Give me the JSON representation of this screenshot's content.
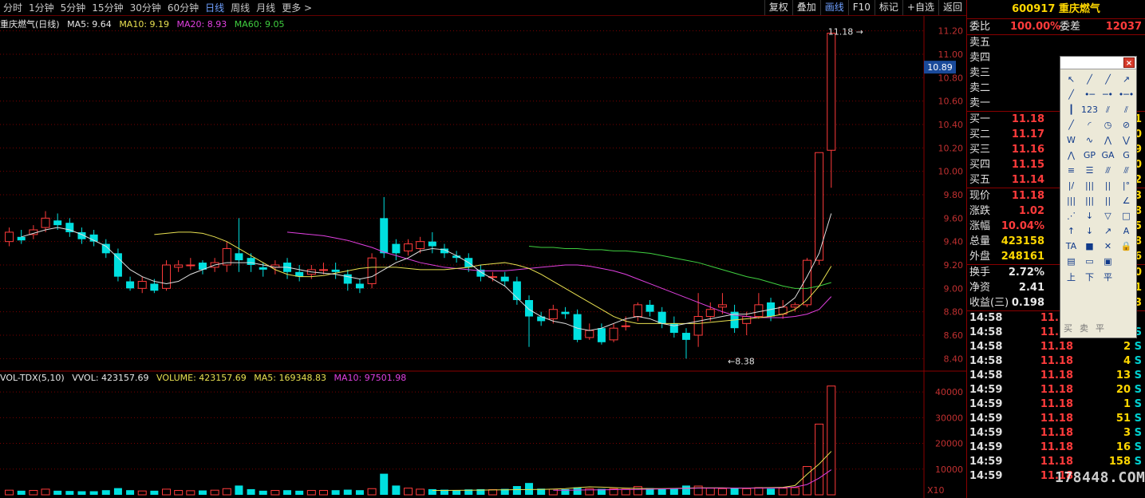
{
  "toolbar": {
    "periods": [
      "分时",
      "1分钟",
      "5分钟",
      "15分钟",
      "30分钟",
      "60分钟",
      "日线",
      "周线",
      "月线",
      "更多 >"
    ],
    "active_period": "日线",
    "right_buttons": [
      "复权",
      "叠加",
      "画线",
      "F10",
      "标记",
      "+自选",
      "返回"
    ],
    "highlight_button": "画线"
  },
  "price_legend": {
    "title": "重庆燃气(日线)",
    "ma5": "MA5: 9.64",
    "ma10": "MA10: 9.19",
    "ma20": "MA20: 8.93",
    "ma60": "MA60: 9.05"
  },
  "volume_legend": {
    "indicator": "VOL-TDX(5,10)",
    "vvol": "VVOL: 423157.69",
    "volume": "VOLUME: 423157.69",
    "ma5": "MA5: 169348.83",
    "ma10": "MA10: 97501.98"
  },
  "annotations": {
    "high_label": "11.18",
    "low_label": "8.38",
    "current_price_tag": "10.89",
    "volume_unit": "X10"
  },
  "colors": {
    "up": "#ff3b3b",
    "down": "#00e0e0",
    "ma5": "#e0e0e0",
    "ma10": "#e8e050",
    "ma20": "#e040e0",
    "ma60": "#40d040",
    "grid": "#7a0000",
    "axis_text": "#c03030"
  },
  "chart_data": [
    {
      "type": "candlestick",
      "title": "重庆燃气(日线)",
      "ylim": [
        8.3,
        11.3
      ],
      "yticks": [
        8.4,
        8.6,
        8.8,
        9.0,
        9.2,
        9.4,
        9.6,
        9.8,
        10.0,
        10.2,
        10.4,
        10.6,
        10.8,
        11.0,
        11.2
      ],
      "candles": [
        [
          9.4,
          9.48,
          9.52,
          9.36
        ],
        [
          9.44,
          9.41,
          9.5,
          9.38
        ],
        [
          9.46,
          9.5,
          9.54,
          9.42
        ],
        [
          9.52,
          9.6,
          9.66,
          9.48
        ],
        [
          9.58,
          9.54,
          9.64,
          9.5
        ],
        [
          9.56,
          9.48,
          9.6,
          9.44
        ],
        [
          9.48,
          9.42,
          9.52,
          9.38
        ],
        [
          9.46,
          9.4,
          9.5,
          9.36
        ],
        [
          9.38,
          9.3,
          9.42,
          9.26
        ],
        [
          9.3,
          9.1,
          9.34,
          9.06
        ],
        [
          9.06,
          9.0,
          9.1,
          8.98
        ],
        [
          9.0,
          9.06,
          9.1,
          8.96
        ],
        [
          9.04,
          8.98,
          9.08,
          8.96
        ],
        [
          9.0,
          9.2,
          9.24,
          8.98
        ],
        [
          9.18,
          9.2,
          9.24,
          9.14
        ],
        [
          9.2,
          9.2,
          9.26,
          9.16
        ],
        [
          9.22,
          9.16,
          9.24,
          9.12
        ],
        [
          9.18,
          9.22,
          9.26,
          9.14
        ],
        [
          9.2,
          9.34,
          9.4,
          9.14
        ],
        [
          9.3,
          9.24,
          9.6,
          9.14
        ],
        [
          9.26,
          9.2,
          9.3,
          9.14
        ],
        [
          9.18,
          9.16,
          9.22,
          9.1
        ],
        [
          9.18,
          9.2,
          9.24,
          9.12
        ],
        [
          9.22,
          9.14,
          9.26,
          9.08
        ],
        [
          9.14,
          9.1,
          9.2,
          9.06
        ],
        [
          9.12,
          9.16,
          9.2,
          9.08
        ],
        [
          9.16,
          9.16,
          9.22,
          9.12
        ],
        [
          9.16,
          9.14,
          9.22,
          9.08
        ],
        [
          9.12,
          9.04,
          9.16,
          8.98
        ],
        [
          9.04,
          9.0,
          9.08,
          8.96
        ],
        [
          9.04,
          9.26,
          9.3,
          9.0
        ],
        [
          9.6,
          9.3,
          9.78,
          9.26
        ],
        [
          9.38,
          9.3,
          9.42,
          9.24
        ],
        [
          9.32,
          9.38,
          9.42,
          9.28
        ],
        [
          9.34,
          9.4,
          9.44,
          9.3
        ],
        [
          9.4,
          9.36,
          9.48,
          9.3
        ],
        [
          9.34,
          9.3,
          9.38,
          9.26
        ],
        [
          9.28,
          9.26,
          9.32,
          9.22
        ],
        [
          9.26,
          9.18,
          9.3,
          9.14
        ],
        [
          9.16,
          9.1,
          9.2,
          9.06
        ],
        [
          9.1,
          9.1,
          9.14,
          9.06
        ],
        [
          9.1,
          9.06,
          9.14,
          9.02
        ],
        [
          9.06,
          8.9,
          9.1,
          8.86
        ],
        [
          8.9,
          8.76,
          8.94,
          8.5
        ],
        [
          8.76,
          8.72,
          8.8,
          8.68
        ],
        [
          8.74,
          8.82,
          8.86,
          8.7
        ],
        [
          8.8,
          8.78,
          8.84,
          8.74
        ],
        [
          8.78,
          8.56,
          8.82,
          8.54
        ],
        [
          8.58,
          8.64,
          8.7,
          8.56
        ],
        [
          8.66,
          8.54,
          8.7,
          8.52
        ],
        [
          8.56,
          8.66,
          8.7,
          8.54
        ],
        [
          8.68,
          8.68,
          8.76,
          8.64
        ],
        [
          8.76,
          8.86,
          8.88,
          8.72
        ],
        [
          8.86,
          8.8,
          8.9,
          8.76
        ],
        [
          8.8,
          8.7,
          8.84,
          8.66
        ],
        [
          8.7,
          8.62,
          8.76,
          8.58
        ],
        [
          8.62,
          8.56,
          8.66,
          8.4
        ],
        [
          8.6,
          8.76,
          8.96,
          8.5
        ],
        [
          8.76,
          8.82,
          8.88,
          8.72
        ],
        [
          8.84,
          8.86,
          8.96,
          8.78
        ],
        [
          8.8,
          8.66,
          8.86,
          8.62
        ],
        [
          8.7,
          8.76,
          8.8,
          8.6
        ],
        [
          8.76,
          8.86,
          8.96,
          8.74
        ],
        [
          8.88,
          8.76,
          8.92,
          8.72
        ],
        [
          8.78,
          8.84,
          8.9,
          8.74
        ],
        [
          8.84,
          8.86,
          8.88,
          8.8
        ],
        [
          8.86,
          9.24,
          9.26,
          8.84
        ],
        [
          9.24,
          10.16,
          10.16,
          9.2
        ],
        [
          10.18,
          11.18,
          11.18,
          9.86
        ]
      ],
      "ma5": [
        9.44,
        9.47,
        9.5,
        9.52,
        9.5,
        9.46,
        9.41,
        9.36,
        9.26,
        9.16,
        9.1,
        9.06,
        9.04,
        9.06,
        9.12,
        9.16,
        9.2,
        9.22,
        9.22,
        9.22,
        9.2,
        9.18,
        9.18,
        9.16,
        9.14,
        9.13,
        9.12,
        9.1,
        9.08,
        9.1,
        9.16,
        9.22,
        9.26,
        9.32,
        9.34,
        9.33,
        9.28,
        9.22,
        9.14,
        9.08,
        9.02,
        8.92,
        8.82,
        8.76,
        8.72,
        8.7,
        8.66,
        8.64,
        8.66,
        8.7,
        8.74,
        8.76,
        8.74,
        8.7,
        8.68,
        8.7,
        8.72,
        8.74,
        8.76,
        8.78,
        8.78,
        8.8,
        8.82,
        8.84,
        8.92,
        9.1,
        9.3,
        9.64
      ],
      "ma10": [
        9.46,
        9.47,
        9.48,
        9.48,
        9.47,
        9.44,
        9.4,
        9.34,
        9.28,
        9.22,
        9.16,
        9.12,
        9.1,
        9.1,
        9.11,
        9.13,
        9.15,
        9.17,
        9.18,
        9.18,
        9.18,
        9.17,
        9.16,
        9.16,
        9.16,
        9.17,
        9.18,
        9.2,
        9.21,
        9.22,
        9.2,
        9.17,
        9.12,
        9.06,
        9.0,
        8.94,
        8.88,
        8.82,
        8.76,
        8.72,
        8.7,
        8.7,
        8.7,
        8.7,
        8.7,
        8.7,
        8.71,
        8.72,
        8.73,
        8.74,
        8.75,
        8.76,
        8.78,
        8.82,
        8.9,
        9.02,
        9.19
      ],
      "ma20": [
        9.48,
        9.47,
        9.46,
        9.45,
        9.43,
        9.41,
        9.38,
        9.35,
        9.31,
        9.28,
        9.25,
        9.22,
        9.2,
        9.18,
        9.17,
        9.16,
        9.15,
        9.15,
        9.15,
        9.16,
        9.17,
        9.18,
        9.19,
        9.2,
        9.2,
        9.19,
        9.17,
        9.15,
        9.12,
        9.08,
        9.04,
        9.0,
        8.96,
        8.92,
        8.88,
        8.84,
        8.8,
        8.77,
        8.76,
        8.75,
        8.75,
        8.75,
        8.76,
        8.78,
        8.82,
        8.93
      ],
      "ma60": [
        9.36,
        9.35,
        9.35,
        9.34,
        9.34,
        9.33,
        9.33,
        9.32,
        9.32,
        9.31,
        9.3,
        9.28,
        9.26,
        9.24,
        9.22,
        9.19,
        9.16,
        9.13,
        9.1,
        9.08,
        9.05,
        9.02,
        9.0,
        9.0,
        9.02,
        9.05
      ]
    },
    {
      "type": "bar",
      "title": "VOL-TDX(5,10)",
      "ylim": [
        0,
        45000
      ],
      "yticks": [
        10000,
        20000,
        30000,
        40000
      ],
      "volumes": [
        1800,
        1600,
        1700,
        2200,
        1600,
        1500,
        1400,
        1400,
        1800,
        2600,
        1800,
        1500,
        1600,
        2200,
        1700,
        1600,
        1700,
        1800,
        2400,
        3600,
        2200,
        1600,
        1700,
        1800,
        1600,
        1700,
        1700,
        1800,
        2000,
        1800,
        2400,
        8200,
        3600,
        2600,
        2200,
        2200,
        2000,
        1800,
        2100,
        2200,
        2000,
        2300,
        3400,
        4600,
        2400,
        2200,
        2200,
        2900,
        2400,
        2300,
        2400,
        2200,
        3200,
        2600,
        2300,
        2400,
        3600,
        3400,
        2600,
        2400,
        2600,
        2400,
        2800,
        2400,
        2600,
        2800,
        11000,
        27500,
        42300
      ],
      "vol_ma5": [
        1700,
        1720,
        1760,
        1800,
        1820,
        1900,
        1950,
        2000,
        2050,
        2100,
        2200,
        2400,
        2800,
        3100,
        3000,
        2800,
        2600,
        2500,
        2400,
        2400,
        2500,
        2600,
        2700,
        2700,
        2700,
        2600,
        2600,
        2700,
        2800,
        2900,
        3600,
        8000,
        12000,
        16900
      ],
      "vol_ma10": [
        1800,
        1800,
        1850,
        1900,
        1950,
        2000,
        2050,
        2100,
        2200,
        2300,
        2400,
        2500,
        2600,
        2600,
        2600,
        2600,
        2600,
        2600,
        2650,
        2700,
        3000,
        4000,
        6500,
        9750
      ]
    }
  ],
  "quote_panel": {
    "title": "600917 重庆燃气",
    "weibi_label": "委比",
    "weibi_value": "100.00%",
    "weicha_label": "委差",
    "weicha_value": "12037",
    "sells": [
      {
        "label": "卖五",
        "price": "",
        "vol": ""
      },
      {
        "label": "卖四",
        "price": "",
        "vol": ""
      },
      {
        "label": "卖三",
        "price": "",
        "vol": ""
      },
      {
        "label": "卖二",
        "price": "",
        "vol": ""
      },
      {
        "label": "卖一",
        "price": "",
        "vol": ""
      }
    ],
    "buys": [
      {
        "label": "买一",
        "price": "11.18",
        "vol": "1"
      },
      {
        "label": "买二",
        "price": "11.17",
        "vol": "0"
      },
      {
        "label": "买三",
        "price": "11.16",
        "vol": "9"
      },
      {
        "label": "买四",
        "price": "11.15",
        "vol": "0"
      },
      {
        "label": "买五",
        "price": "11.14",
        "vol": "2"
      }
    ],
    "stats": [
      {
        "label": "现价",
        "value": "11.18",
        "extra": "3"
      },
      {
        "label": "涨跌",
        "value": "1.02",
        "extra": "8"
      },
      {
        "label": "涨幅",
        "value": "10.04%",
        "extra": "5"
      },
      {
        "label": "总量",
        "value": "423158",
        "extra": "8"
      },
      {
        "label": "外盘",
        "value": "248161",
        "extra": "6"
      }
    ],
    "stats2": [
      {
        "label": "换手",
        "value": "2.72%",
        "extra": "0"
      },
      {
        "label": "净资",
        "value": "2.41",
        "extra": "1"
      },
      {
        "label": "收益(三)",
        "value": "0.198",
        "extra": "3"
      }
    ],
    "ticks": [
      {
        "time": "14:58",
        "price": "11.18",
        "vol": "",
        "side": ""
      },
      {
        "time": "14:58",
        "price": "11.18",
        "vol": "20",
        "side": "S"
      },
      {
        "time": "14:58",
        "price": "11.18",
        "vol": "2",
        "side": "S"
      },
      {
        "time": "14:58",
        "price": "11.18",
        "vol": "4",
        "side": "S"
      },
      {
        "time": "14:58",
        "price": "11.18",
        "vol": "13",
        "side": "S"
      },
      {
        "time": "14:59",
        "price": "11.18",
        "vol": "20",
        "side": "S"
      },
      {
        "time": "14:59",
        "price": "11.18",
        "vol": "1",
        "side": "S"
      },
      {
        "time": "14:59",
        "price": "11.18",
        "vol": "51",
        "side": "S"
      },
      {
        "time": "14:59",
        "price": "11.18",
        "vol": "3",
        "side": "S"
      },
      {
        "time": "14:59",
        "price": "11.18",
        "vol": "16",
        "side": "S"
      },
      {
        "time": "14:59",
        "price": "11.18",
        "vol": "158",
        "side": "S"
      },
      {
        "time": "14:59",
        "price": "11.18",
        "vol": "",
        "side": ""
      }
    ]
  },
  "toolbox": {
    "close_label": "×",
    "tools": [
      {
        "name": "pointer-tool-icon",
        "glyph": "↖"
      },
      {
        "name": "line-tool-icon",
        "glyph": "╱"
      },
      {
        "name": "ray-line-tool-icon",
        "glyph": "╱"
      },
      {
        "name": "arrow-line-tool-icon",
        "glyph": "↗"
      },
      {
        "name": "segment-tool-icon",
        "glyph": "╱"
      },
      {
        "name": "horizontal-segment-tool-icon",
        "glyph": "•─"
      },
      {
        "name": "horizontal-line-tool-icon",
        "glyph": "─•"
      },
      {
        "name": "horizontal-ray-tool-icon",
        "glyph": "•─•"
      },
      {
        "name": "vertical-line-tool-icon",
        "glyph": "┃"
      },
      {
        "name": "number-tool-icon",
        "glyph": "123"
      },
      {
        "name": "parallel-line-tool-icon",
        "glyph": "⫽"
      },
      {
        "name": "channel-tool-icon",
        "glyph": "⫽"
      },
      {
        "name": "trend-line-tool-icon",
        "glyph": "╱"
      },
      {
        "name": "arc-tool-icon",
        "glyph": "◜"
      },
      {
        "name": "circle-tool-icon",
        "glyph": "◷"
      },
      {
        "name": "gann-fan-tool-icon",
        "glyph": "⊘"
      },
      {
        "name": "wave-tool-icon",
        "glyph": "W"
      },
      {
        "name": "wave2-tool-icon",
        "glyph": "∿"
      },
      {
        "name": "zigzag-tool-icon",
        "glyph": "⋀"
      },
      {
        "name": "zigzag2-tool-icon",
        "glyph": "⋁"
      },
      {
        "name": "mountain-tool-icon",
        "glyph": "⋀"
      },
      {
        "name": "gp-tool-icon",
        "glyph": "GP"
      },
      {
        "name": "ga-tool-icon",
        "glyph": "GA"
      },
      {
        "name": "g-tool-icon",
        "glyph": "G"
      },
      {
        "name": "fibonacci-tool-icon",
        "glyph": "≡"
      },
      {
        "name": "ratio-lines-tool-icon",
        "glyph": "☰"
      },
      {
        "name": "speed-lines-tool-icon",
        "glyph": "⫻"
      },
      {
        "name": "speed-lines2-tool-icon",
        "glyph": "⫻"
      },
      {
        "name": "bracket-tool-icon",
        "glyph": "|/"
      },
      {
        "name": "time-cycle-tool-icon",
        "glyph": "|||"
      },
      {
        "name": "fib-time-tool-icon",
        "glyph": "||"
      },
      {
        "name": "cycle-tool-icon",
        "glyph": "|°"
      },
      {
        "name": "bars-tool-icon",
        "glyph": "|||"
      },
      {
        "name": "bars2-tool-icon",
        "glyph": "|||"
      },
      {
        "name": "bars3-tool-icon",
        "glyph": "||"
      },
      {
        "name": "angle-tool-icon",
        "glyph": "∠"
      },
      {
        "name": "fan-tool-icon",
        "glyph": "⋰"
      },
      {
        "name": "down-arrow-line-tool-icon",
        "glyph": "↓"
      },
      {
        "name": "triangle-tool-icon",
        "glyph": "▽"
      },
      {
        "name": "rectangle-tool-icon",
        "glyph": "□"
      },
      {
        "name": "up-arrow-tool-icon",
        "glyph": "↑"
      },
      {
        "name": "down-arrow-tool-icon",
        "glyph": "↓"
      },
      {
        "name": "cross-arrow-tool-icon",
        "glyph": "↗"
      },
      {
        "name": "text-tool-icon",
        "glyph": "A"
      },
      {
        "name": "text-style-tool-icon",
        "glyph": "TA"
      },
      {
        "name": "gray-box-tool-icon",
        "glyph": "■"
      },
      {
        "name": "delete-tool-icon",
        "glyph": "✕"
      },
      {
        "name": "lock-tool-icon",
        "glyph": "🔒"
      },
      {
        "name": "note-tool-icon",
        "glyph": "▤"
      },
      {
        "name": "ruler-tool-icon",
        "glyph": "▭"
      },
      {
        "name": "image-tool-icon",
        "glyph": "▣"
      },
      {
        "name": "blank-tool-icon",
        "glyph": ""
      },
      {
        "name": "buy-mark-tool-icon",
        "glyph": "上"
      },
      {
        "name": "sell-mark-tool-icon",
        "glyph": "下"
      },
      {
        "name": "flat-mark-tool-icon",
        "glyph": "平"
      }
    ],
    "footer": [
      "买",
      "卖",
      "平"
    ]
  },
  "watermark": "178448.COM"
}
